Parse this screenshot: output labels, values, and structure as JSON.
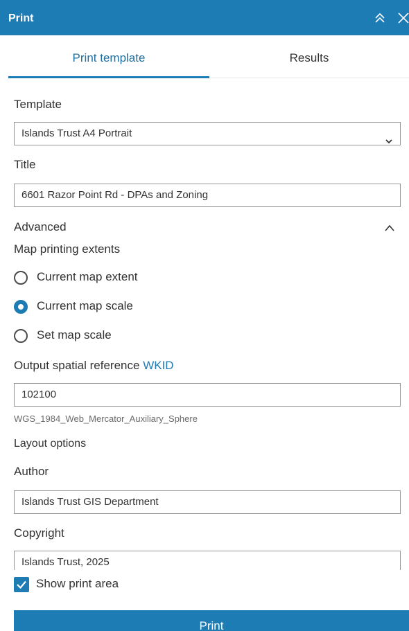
{
  "header": {
    "title": "Print",
    "collapse_icon": "double-chevron-up-icon",
    "close_icon": "close-icon"
  },
  "tabs": [
    {
      "label": "Print template",
      "active": true
    },
    {
      "label": "Results",
      "active": false
    }
  ],
  "form": {
    "template_label": "Template",
    "template_value": "Islands Trust A4 Portrait",
    "title_label": "Title",
    "title_value": "6601 Razor Point Rd - DPAs and Zoning",
    "advanced_label": "Advanced",
    "extents_label": "Map printing extents",
    "extent_options": [
      {
        "label": "Current map extent",
        "selected": false
      },
      {
        "label": "Current map scale",
        "selected": true
      },
      {
        "label": "Set map scale",
        "selected": false
      }
    ],
    "spatial_ref_label": "Output spatial reference",
    "spatial_ref_link": "WKID",
    "spatial_ref_value": "102100",
    "spatial_ref_name": "WGS_1984_Web_Mercator_Auxiliary_Sphere",
    "layout_options_label": "Layout options",
    "author_label": "Author",
    "author_value": "Islands Trust GIS Department",
    "copyright_label": "Copyright",
    "copyright_value": "Islands Trust, 2025",
    "show_print_area_label": "Show print area",
    "show_print_area_checked": true
  },
  "actions": {
    "print_label": "Print"
  },
  "colors": {
    "accent": "#1e7cb5",
    "header_bg": "#1e7cb5"
  }
}
